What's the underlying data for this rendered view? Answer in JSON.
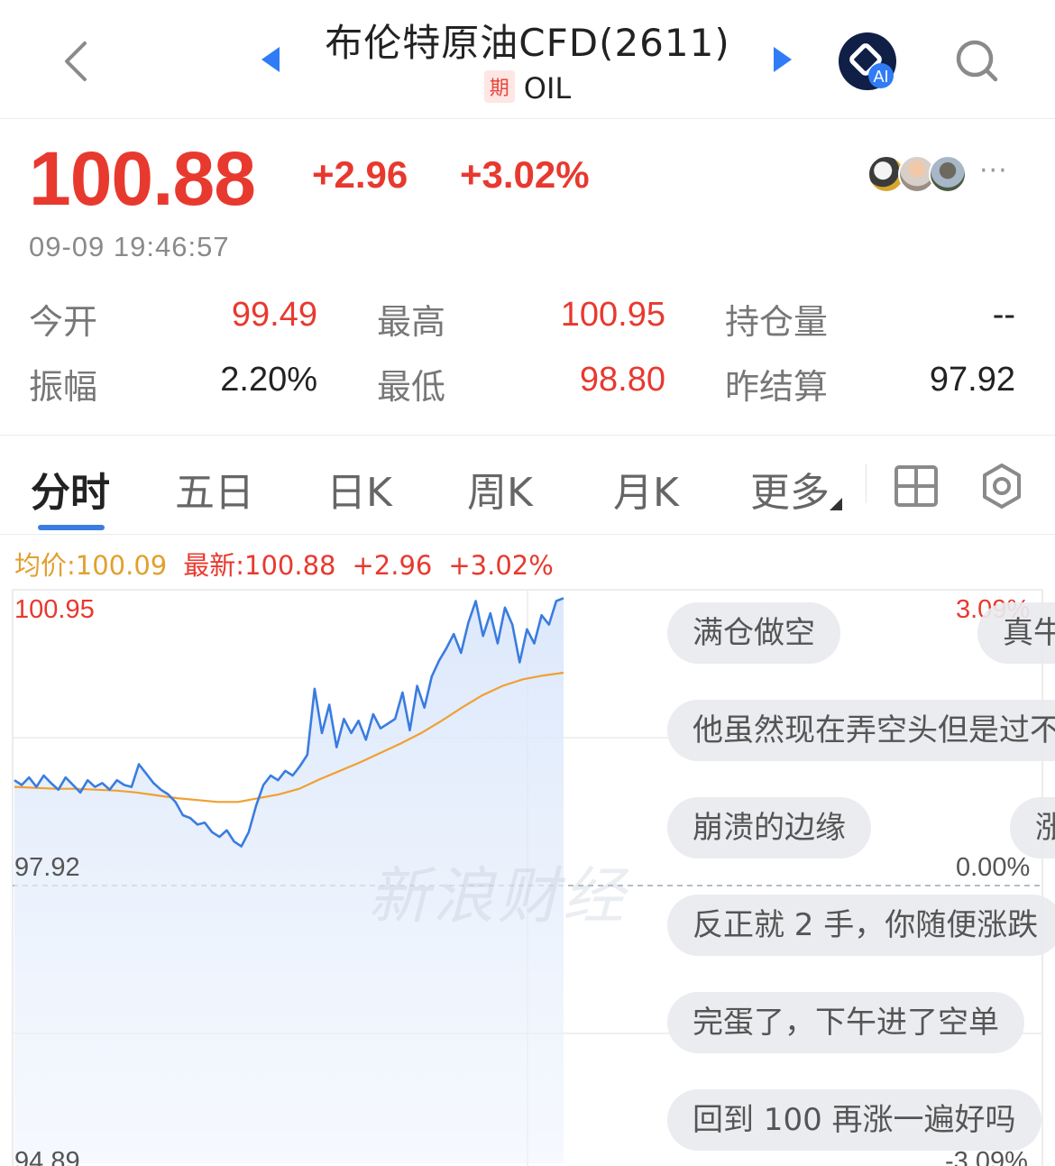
{
  "header": {
    "title": "布伦特原油CFD(2611)",
    "tag": "期",
    "code": "OIL",
    "ai_badge": "AI",
    "icons": {
      "back": "chevron-left-icon",
      "prev": "triangle-left-icon",
      "next": "triangle-right-icon",
      "ai": "ai-assistant-icon",
      "search": "search-icon"
    }
  },
  "quote": {
    "price": "100.88",
    "change": "+2.96",
    "change_pct": "+3.02%",
    "timestamp": "09-09 19:46:57",
    "more": "···"
  },
  "stats": {
    "open_label": "今开",
    "open": "99.49",
    "high_label": "最高",
    "high": "100.95",
    "oi_label": "持仓量",
    "oi": "--",
    "amp_label": "振幅",
    "amp": "2.20%",
    "low_label": "最低",
    "low": "98.80",
    "prev_settle_label": "昨结算",
    "prev_settle": "97.92"
  },
  "tabs": [
    {
      "label": "分时",
      "active": true
    },
    {
      "label": "五日"
    },
    {
      "label": "日K"
    },
    {
      "label": "周K"
    },
    {
      "label": "月K"
    },
    {
      "label": "更多"
    }
  ],
  "chart_info": {
    "avg": "均价:100.09",
    "latest": "最新:100.88",
    "change": "+2.96",
    "change_pct": "+3.02%"
  },
  "chart_data": {
    "type": "line",
    "y_top": "100.95",
    "y_mid": "97.92",
    "y_bottom": "94.89",
    "pct_top": "3.09%",
    "pct_mid": "0.00%",
    "pct_bottom": "-3.09%",
    "ylim": [
      94.89,
      100.95
    ],
    "reference": 97.92,
    "series": [
      {
        "type": "price",
        "values": [
          98.95,
          98.9,
          98.98,
          98.88,
          99.0,
          98.92,
          98.85,
          98.98,
          98.9,
          98.82,
          98.95,
          98.88,
          98.92,
          98.85,
          98.95,
          98.9,
          98.88,
          99.12,
          99.02,
          98.92,
          98.85,
          98.8,
          98.72,
          98.58,
          98.55,
          98.48,
          98.5,
          98.4,
          98.35,
          98.42,
          98.3,
          98.25,
          98.4,
          98.68,
          98.9,
          99.0,
          98.95,
          99.05,
          99.0,
          99.1,
          99.22,
          99.92,
          99.45,
          99.75,
          99.3,
          99.6,
          99.45,
          99.58,
          99.38,
          99.65,
          99.5,
          99.55,
          99.6,
          99.88,
          99.48,
          99.95,
          99.72,
          100.05,
          100.22,
          100.35,
          100.5,
          100.3,
          100.62,
          100.85,
          100.48,
          100.72,
          100.4,
          100.78,
          100.6,
          100.2,
          100.55,
          100.4,
          100.7,
          100.6,
          100.85,
          100.88
        ],
        "color": "#3a7ce0"
      },
      {
        "type": "average",
        "values": [
          98.88,
          98.87,
          98.86,
          98.86,
          98.85,
          98.84,
          98.82,
          98.79,
          98.76,
          98.74,
          98.72,
          98.72,
          98.76,
          98.8,
          98.86,
          98.96,
          99.05,
          99.14,
          99.24,
          99.34,
          99.45,
          99.58,
          99.72,
          99.85,
          99.95,
          100.02,
          100.06,
          100.09
        ],
        "color": "#f0a030"
      }
    ]
  },
  "watermark": "新浪财经",
  "danmaku": [
    "满仓做空",
    "真牛",
    "他虽然现在弄空头但是过不",
    "崩溃的边缘",
    "涨",
    "反正就 2 手，你随便涨跌",
    "完蛋了，下午进了空单",
    "回到 100 再涨一遍好吗"
  ],
  "colors": {
    "up": "#e8392f",
    "avg": "#e2a02f",
    "accent": "#3a7ce0",
    "ai_badge": "#2f7cf6"
  }
}
